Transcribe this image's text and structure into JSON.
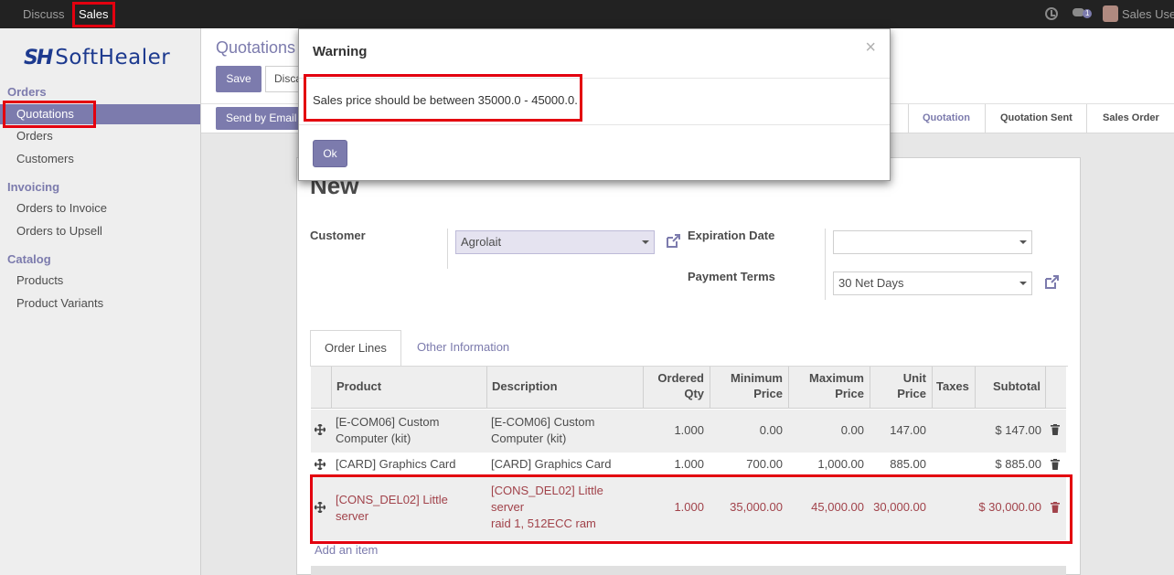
{
  "topbar": {
    "menus": [
      "Discuss",
      "Sales"
    ],
    "notification_count": "1",
    "user": "Sales Use"
  },
  "brand": {
    "mark": "SH",
    "name": "SoftHealer"
  },
  "sidebar": {
    "sections": [
      {
        "title": "Orders",
        "items": [
          "Quotations",
          "Orders",
          "Customers"
        ]
      },
      {
        "title": "Invoicing",
        "items": [
          "Orders to Invoice",
          "Orders to Upsell"
        ]
      },
      {
        "title": "Catalog",
        "items": [
          "Products",
          "Product Variants"
        ]
      }
    ]
  },
  "control": {
    "breadcrumb": "Quotations",
    "save_label": "Save",
    "discard_label": "Discard",
    "send_label": "Send by Email"
  },
  "status_stages": [
    "Quotation",
    "Quotation Sent",
    "Sales Order"
  ],
  "form": {
    "title": "New",
    "customer_label": "Customer",
    "customer_value": "Agrolait",
    "expiration_label": "Expiration Date",
    "expiration_value": "",
    "payment_terms_label": "Payment Terms",
    "payment_terms_value": "30 Net Days"
  },
  "tabs": [
    "Order Lines",
    "Other Information"
  ],
  "table": {
    "headers": {
      "product": "Product",
      "description": "Description",
      "ordered_qty": [
        "Ordered",
        "Qty"
      ],
      "min_price": [
        "Minimum",
        "Price"
      ],
      "max_price": [
        "Maximum",
        "Price"
      ],
      "unit_price": [
        "Unit",
        "Price"
      ],
      "taxes": "Taxes",
      "subtotal": "Subtotal"
    },
    "rows": [
      {
        "product": [
          "[E-COM06] Custom",
          "Computer (kit)"
        ],
        "description": [
          "[E-COM06] Custom",
          "Computer (kit)"
        ],
        "qty": "1.000",
        "min": "0.00",
        "max": "0.00",
        "unit": "147.00",
        "subtotal": "$ 147.00"
      },
      {
        "product": [
          "[CARD] Graphics Card"
        ],
        "description": [
          "[CARD] Graphics Card"
        ],
        "qty": "1.000",
        "min": "700.00",
        "max": "1,000.00",
        "unit": "885.00",
        "subtotal": "$ 885.00"
      },
      {
        "product": [
          "[CONS_DEL02] Little",
          "server"
        ],
        "description": [
          "[CONS_DEL02] Little",
          "server",
          "raid 1, 512ECC ram"
        ],
        "qty": "1.000",
        "min": "35,000.00",
        "max": "45,000.00",
        "unit": "30,000.00",
        "subtotal": "$ 30,000.00"
      }
    ],
    "add_item": "Add an item"
  },
  "modal": {
    "title": "Warning",
    "close": "×",
    "message": "Sales price should be between 35000.0 - 45000.0.",
    "ok_label": "Ok"
  },
  "colors": {
    "accent": "#7c7bad",
    "highlight": "#e3000f",
    "warn_text": "#a1424a"
  }
}
